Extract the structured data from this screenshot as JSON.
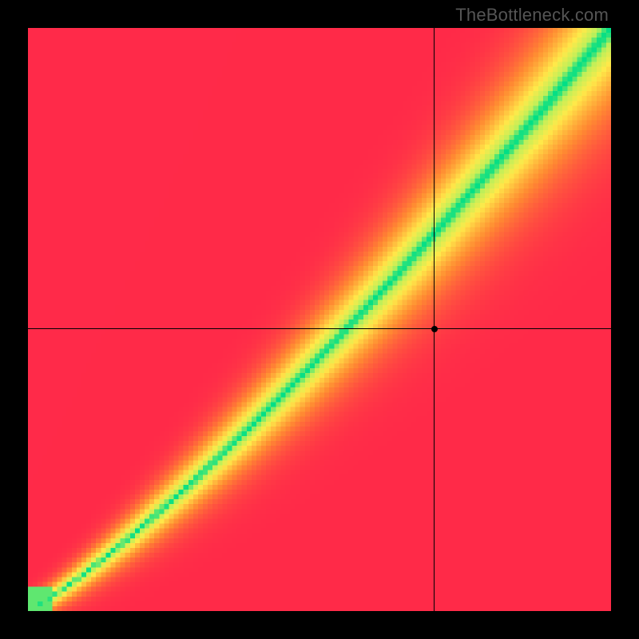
{
  "watermark": "TheBottleneck.com",
  "chart_data": {
    "type": "heatmap",
    "title": "",
    "xlabel": "",
    "ylabel": "",
    "xlim": [
      0,
      1
    ],
    "ylim": [
      0,
      1
    ],
    "grid_size": 120,
    "marker": {
      "x": 0.697,
      "y": 0.484
    },
    "crosshair": {
      "x": 0.697,
      "y": 0.484
    },
    "optimal_band": {
      "center_curve": "y ≈ 0.62·x^1.35 + 0.38·x  (approx)",
      "half_width_at_0": 0.0,
      "half_width_at_1": 0.1
    },
    "colors": {
      "max_deficit": "#ff2a49",
      "mid": "#ffd84a",
      "optimal": "#00df87"
    },
    "legend": []
  }
}
